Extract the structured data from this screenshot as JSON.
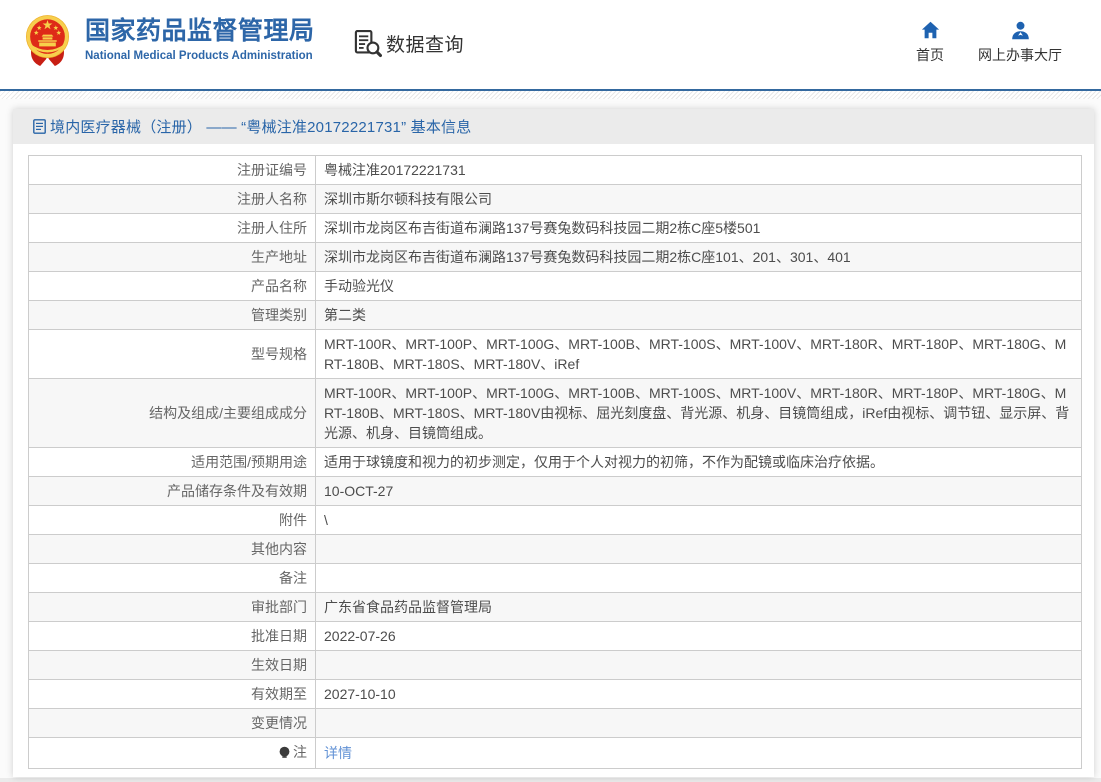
{
  "header": {
    "logo": {
      "title_cn": "国家药品监督管理局",
      "title_en": "National Medical Products Administration"
    },
    "section_label": "数据查询",
    "nav": [
      {
        "label": "首页",
        "icon": "home-icon"
      },
      {
        "label": "网上办事大厅",
        "icon": "user-icon"
      }
    ]
  },
  "page": {
    "title": "境内医疗器械（注册） —— “粤械注准20172221731” 基本信息"
  },
  "table": {
    "rows": [
      {
        "label": "注册证编号",
        "value": "粤械注准20172221731"
      },
      {
        "label": "注册人名称",
        "value": "深圳市斯尔顿科技有限公司"
      },
      {
        "label": "注册人住所",
        "value": "深圳市龙岗区布吉街道布澜路137号赛兔数码科技园二期2栋C座5楼501"
      },
      {
        "label": "生产地址",
        "value": "深圳市龙岗区布吉街道布澜路137号赛兔数码科技园二期2栋C座101、201、301、401"
      },
      {
        "label": "产品名称",
        "value": "手动验光仪"
      },
      {
        "label": "管理类别",
        "value": "第二类"
      },
      {
        "label": "型号规格",
        "value": "MRT-100R、MRT-100P、MRT-100G、MRT-100B、MRT-100S、MRT-100V、MRT-180R、MRT-180P、MRT-180G、MRT-180B、MRT-180S、MRT-180V、iRef"
      },
      {
        "label": "结构及组成/主要组成成分",
        "value": "MRT-100R、MRT-100P、MRT-100G、MRT-100B、MRT-100S、MRT-100V、MRT-180R、MRT-180P、MRT-180G、MRT-180B、MRT-180S、MRT-180V由视标、屈光刻度盘、背光源、机身、目镜筒组成，iRef由视标、调节钮、显示屏、背光源、机身、目镜筒组成。"
      },
      {
        "label": "适用范围/预期用途",
        "value": "适用于球镜度和视力的初步测定，仅用于个人对视力的初筛，不作为配镜或临床治疗依据。"
      },
      {
        "label": "产品储存条件及有效期",
        "value": "10-OCT-27"
      },
      {
        "label": "附件",
        "value": "\\"
      },
      {
        "label": "其他内容",
        "value": ""
      },
      {
        "label": "备注",
        "value": ""
      },
      {
        "label": "审批部门",
        "value": "广东省食品药品监督管理局"
      },
      {
        "label": "批准日期",
        "value": "2022-07-26"
      },
      {
        "label": "生效日期",
        "value": ""
      },
      {
        "label": "有效期至",
        "value": "2027-10-10"
      },
      {
        "label": "变更情况",
        "value": ""
      },
      {
        "label": "注",
        "label_icon": "bulb-icon",
        "value": "详情",
        "link": true
      }
    ]
  },
  "colors": {
    "brand_blue": "#2d66a8",
    "title_blue": "#2965a8",
    "link_blue": "#6292d5",
    "nav_icon_blue": "#1e62b0",
    "stripe_row": "#f7f7f7",
    "table_border": "#cccccc",
    "title_bar_bg": "#ebebeb",
    "emblem_red": "#dd2b1c",
    "emblem_gold": "#f5c33c"
  }
}
